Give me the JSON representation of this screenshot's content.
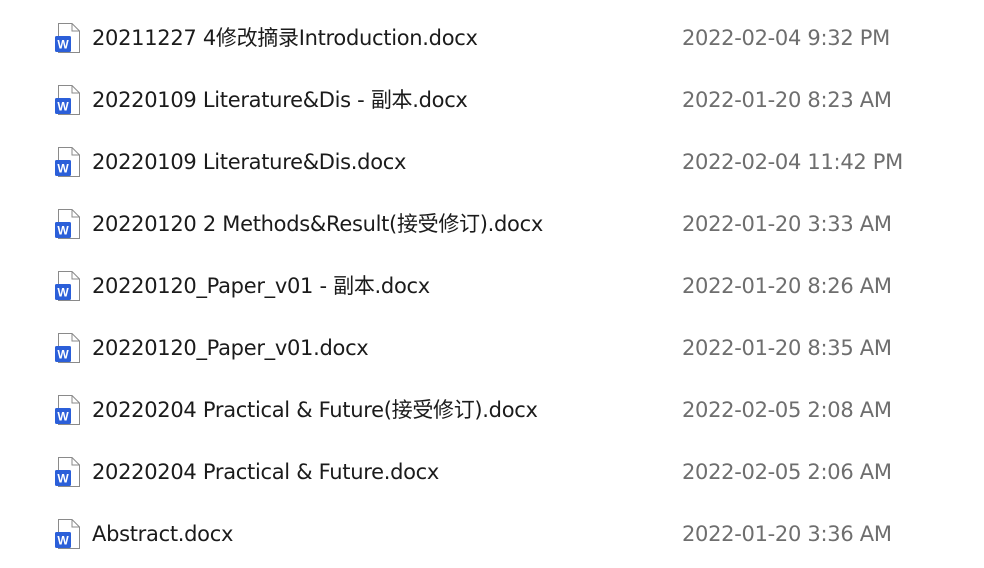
{
  "files": [
    {
      "name": "20211227 4修改摘录Introduction.docx",
      "date": "2022-02-04 9:32 PM",
      "icon": "word-docx-icon"
    },
    {
      "name": "20220109 Literature&Dis - 副本.docx",
      "date": "2022-01-20 8:23 AM",
      "icon": "word-docx-icon"
    },
    {
      "name": "20220109 Literature&Dis.docx",
      "date": "2022-02-04 11:42 PM",
      "icon": "word-docx-icon"
    },
    {
      "name": "20220120 2 Methods&Result(接受修订).docx",
      "date": "2022-01-20 3:33 AM",
      "icon": "word-docx-icon"
    },
    {
      "name": "20220120_Paper_v01 - 副本.docx",
      "date": "2022-01-20 8:26 AM",
      "icon": "word-docx-icon"
    },
    {
      "name": "20220120_Paper_v01.docx",
      "date": "2022-01-20 8:35 AM",
      "icon": "word-docx-icon"
    },
    {
      "name": "20220204 Practical & Future(接受修订).docx",
      "date": "2022-02-05 2:08 AM",
      "icon": "word-docx-icon"
    },
    {
      "name": "20220204 Practical & Future.docx",
      "date": "2022-02-05 2:06 AM",
      "icon": "word-docx-icon"
    },
    {
      "name": "Abstract.docx",
      "date": "2022-01-20 3:36 AM",
      "icon": "word-docx-icon"
    }
  ],
  "colors": {
    "word_blue": "#2b5fd9",
    "page_border": "#8a8a8a",
    "name_text": "#1b1b1b",
    "date_text": "#6e6e6e"
  }
}
